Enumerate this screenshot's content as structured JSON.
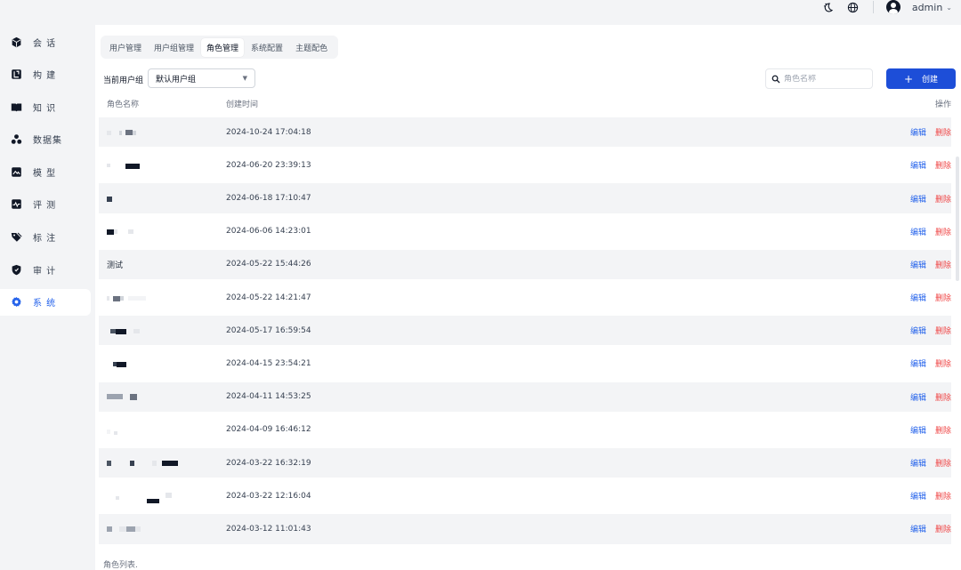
{
  "topbar": {
    "user_name": "admin",
    "caret": "⌄",
    "icons": [
      "theme-toggle-icon",
      "globe-icon",
      "user-avatar-icon"
    ]
  },
  "sidebar": {
    "items": [
      {
        "label": "会 话",
        "icon": "cube-icon"
      },
      {
        "label": "构 建",
        "icon": "build-icon"
      },
      {
        "label": "知 识",
        "icon": "book-icon"
      },
      {
        "label": "数据集",
        "icon": "dataset-icon"
      },
      {
        "label": "模 型",
        "icon": "model-icon"
      },
      {
        "label": "评 测",
        "icon": "evaluate-icon"
      },
      {
        "label": "标 注",
        "icon": "tag-icon"
      },
      {
        "label": "审 计",
        "icon": "shield-icon"
      },
      {
        "label": "系 统",
        "icon": "gear-icon",
        "active": true
      }
    ],
    "active_color": "#2563eb"
  },
  "tabs": [
    {
      "label": "用户管理"
    },
    {
      "label": "用户组管理"
    },
    {
      "label": "角色管理",
      "active": true
    },
    {
      "label": "系统配置"
    },
    {
      "label": "主题配色"
    }
  ],
  "filter": {
    "label": "当前用户组",
    "selected": "默认用户组"
  },
  "search": {
    "placeholder": "角色名称"
  },
  "create_button": {
    "plus": "+",
    "label": "创建",
    "color": "#1d4ed8"
  },
  "table": {
    "headers": {
      "name": "角色名称",
      "created": "创建时间",
      "ops": "操作"
    },
    "edit_label": "编辑",
    "delete_label": "删除",
    "rows": [
      {
        "name": "",
        "created": "2024-10-24 17:04:18"
      },
      {
        "name": "",
        "created": "2024-06-20 23:39:13"
      },
      {
        "name": "",
        "created": "2024-06-18 17:10:47"
      },
      {
        "name": "",
        "created": "2024-06-06 14:23:01"
      },
      {
        "name": "测试",
        "created": "2024-05-22 15:44:26"
      },
      {
        "name": "",
        "created": "2024-05-22 14:21:47"
      },
      {
        "name": "",
        "created": "2024-05-17 16:59:54"
      },
      {
        "name": "",
        "created": "2024-04-15 23:54:21"
      },
      {
        "name": "",
        "created": "2024-04-11 14:53:25"
      },
      {
        "name": "",
        "created": "2024-04-09 16:46:12"
      },
      {
        "name": "",
        "created": "2024-03-22 16:32:19"
      },
      {
        "name": "",
        "created": "2024-03-22 12:16:04"
      },
      {
        "name": "",
        "created": "2024-03-12 11:01:43"
      }
    ],
    "caption": "角色列表."
  }
}
